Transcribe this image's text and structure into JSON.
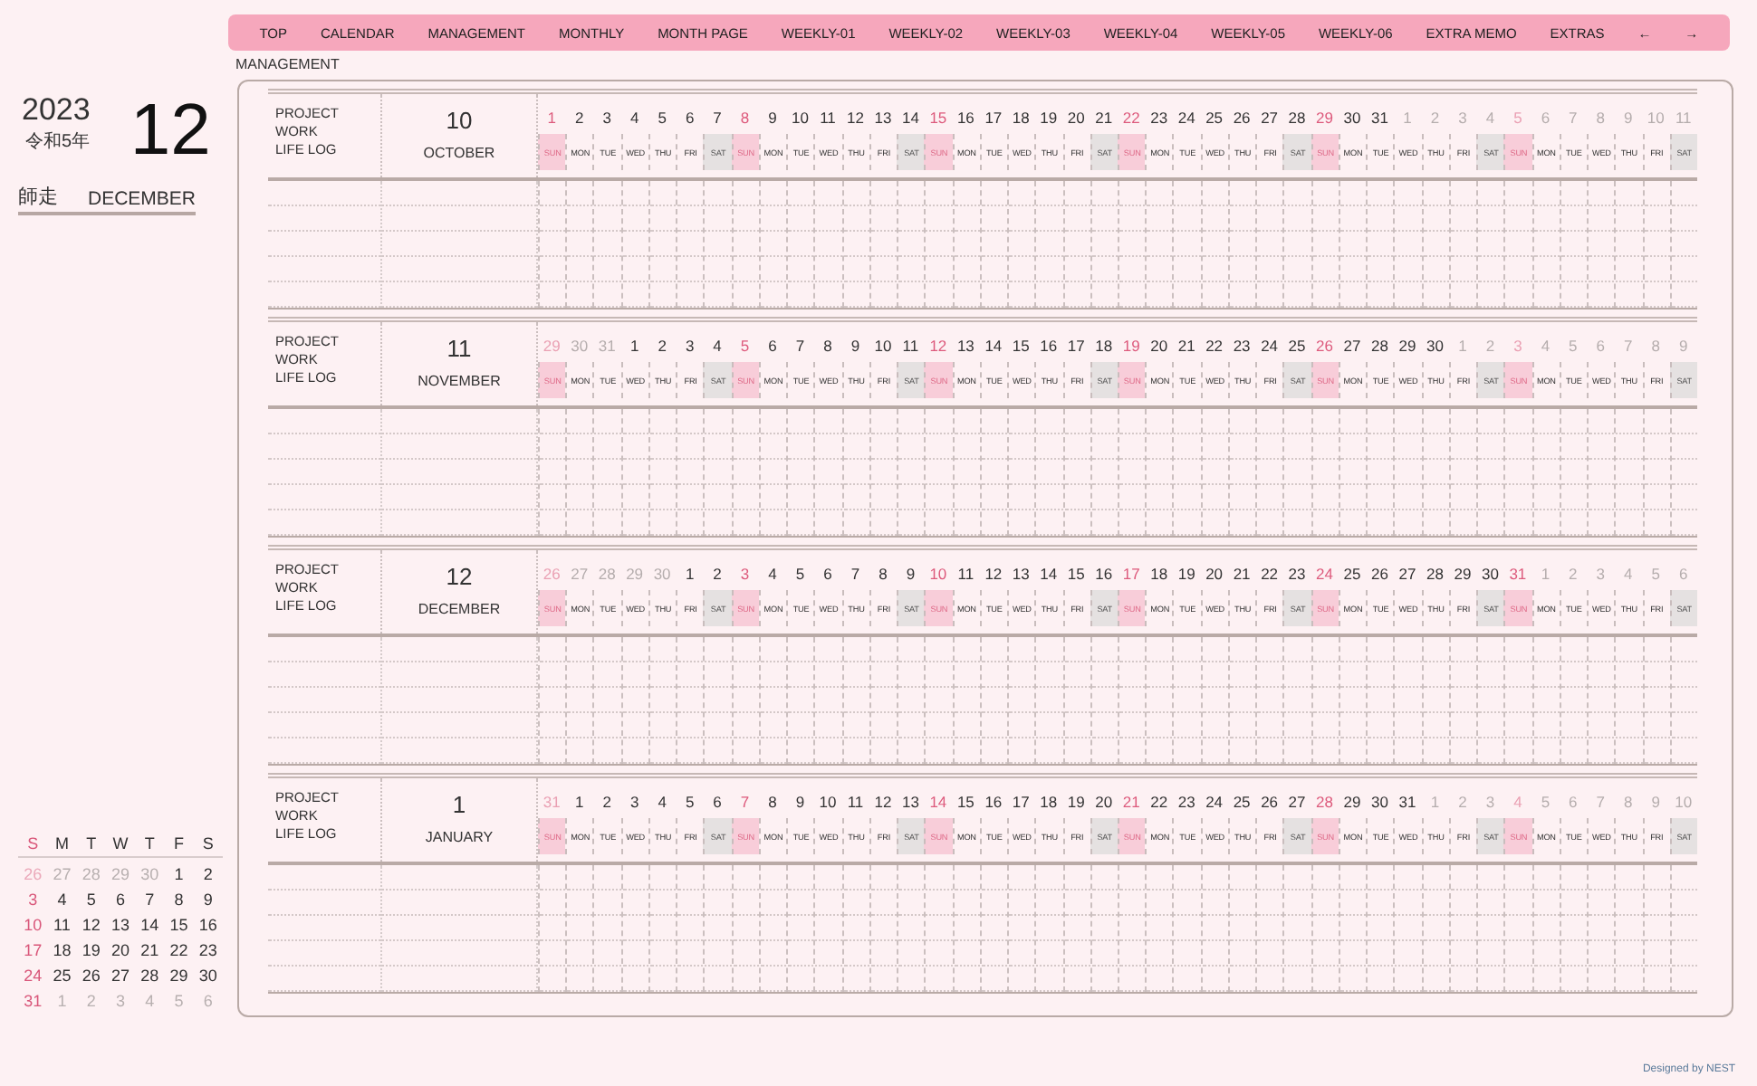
{
  "nav": [
    {
      "label": "TOP"
    },
    {
      "label": "CALENDAR"
    },
    {
      "label": "MANAGEMENT"
    },
    {
      "label": "MONTHLY"
    },
    {
      "label": "MONTH PAGE"
    },
    {
      "label": "WEEKLY-01"
    },
    {
      "label": "WEEKLY-02"
    },
    {
      "label": "WEEKLY-03"
    },
    {
      "label": "WEEKLY-04"
    },
    {
      "label": "WEEKLY-05"
    },
    {
      "label": "WEEKLY-06"
    },
    {
      "label": "EXTRA MEMO"
    },
    {
      "label": "EXTRAS"
    },
    {
      "label": "←"
    },
    {
      "label": "→"
    }
  ],
  "section_label": "MANAGEMENT",
  "side": {
    "year": "2023",
    "era_year": "令和5年",
    "month_number": "12",
    "month_name_japanese": "師走",
    "month_name": "DECEMBER"
  },
  "mini_calendar": {
    "headers": [
      "S",
      "M",
      "T",
      "W",
      "T",
      "F",
      "S"
    ],
    "weeks": [
      [
        {
          "n": "26",
          "out": true
        },
        {
          "n": "27",
          "out": true
        },
        {
          "n": "28",
          "out": true
        },
        {
          "n": "29",
          "out": true
        },
        {
          "n": "30",
          "out": true
        },
        {
          "n": "1",
          "out": false
        },
        {
          "n": "2",
          "out": false
        }
      ],
      [
        {
          "n": "3",
          "out": false
        },
        {
          "n": "4",
          "out": false
        },
        {
          "n": "5",
          "out": false
        },
        {
          "n": "6",
          "out": false
        },
        {
          "n": "7",
          "out": false
        },
        {
          "n": "8",
          "out": false
        },
        {
          "n": "9",
          "out": false
        }
      ],
      [
        {
          "n": "10",
          "out": false
        },
        {
          "n": "11",
          "out": false
        },
        {
          "n": "12",
          "out": false
        },
        {
          "n": "13",
          "out": false
        },
        {
          "n": "14",
          "out": false
        },
        {
          "n": "15",
          "out": false
        },
        {
          "n": "16",
          "out": false
        }
      ],
      [
        {
          "n": "17",
          "out": false
        },
        {
          "n": "18",
          "out": false
        },
        {
          "n": "19",
          "out": false
        },
        {
          "n": "20",
          "out": false
        },
        {
          "n": "21",
          "out": false
        },
        {
          "n": "22",
          "out": false
        },
        {
          "n": "23",
          "out": false
        }
      ],
      [
        {
          "n": "24",
          "out": false
        },
        {
          "n": "25",
          "out": false
        },
        {
          "n": "26",
          "out": false
        },
        {
          "n": "27",
          "out": false
        },
        {
          "n": "28",
          "out": false
        },
        {
          "n": "29",
          "out": false
        },
        {
          "n": "30",
          "out": false
        }
      ],
      [
        {
          "n": "31",
          "out": false
        },
        {
          "n": "1",
          "out": true
        },
        {
          "n": "2",
          "out": true
        },
        {
          "n": "3",
          "out": true
        },
        {
          "n": "4",
          "out": true
        },
        {
          "n": "5",
          "out": true
        },
        {
          "n": "6",
          "out": true
        }
      ]
    ]
  },
  "blocks": [
    {
      "labels": [
        "PROJECT",
        "WORK",
        "LIFE LOG"
      ],
      "month_number": "10",
      "month_name": "OCTOBER",
      "days": [
        {
          "n": "1",
          "w": "SUN",
          "kind": "sun",
          "out": false
        },
        {
          "n": "2",
          "w": "MON",
          "kind": "day",
          "out": false
        },
        {
          "n": "3",
          "w": "TUE",
          "kind": "day",
          "out": false
        },
        {
          "n": "4",
          "w": "WED",
          "kind": "day",
          "out": false
        },
        {
          "n": "5",
          "w": "THU",
          "kind": "day",
          "out": false
        },
        {
          "n": "6",
          "w": "FRI",
          "kind": "day",
          "out": false
        },
        {
          "n": "7",
          "w": "SAT",
          "kind": "sat",
          "out": false
        },
        {
          "n": "8",
          "w": "SUN",
          "kind": "sun",
          "out": false
        },
        {
          "n": "9",
          "w": "MON",
          "kind": "day",
          "out": false
        },
        {
          "n": "10",
          "w": "TUE",
          "kind": "day",
          "out": false
        },
        {
          "n": "11",
          "w": "WED",
          "kind": "day",
          "out": false
        },
        {
          "n": "12",
          "w": "THU",
          "kind": "day",
          "out": false
        },
        {
          "n": "13",
          "w": "FRI",
          "kind": "day",
          "out": false
        },
        {
          "n": "14",
          "w": "SAT",
          "kind": "sat",
          "out": false
        },
        {
          "n": "15",
          "w": "SUN",
          "kind": "sun",
          "out": false
        },
        {
          "n": "16",
          "w": "MON",
          "kind": "day",
          "out": false
        },
        {
          "n": "17",
          "w": "TUE",
          "kind": "day",
          "out": false
        },
        {
          "n": "18",
          "w": "WED",
          "kind": "day",
          "out": false
        },
        {
          "n": "19",
          "w": "THU",
          "kind": "day",
          "out": false
        },
        {
          "n": "20",
          "w": "FRI",
          "kind": "day",
          "out": false
        },
        {
          "n": "21",
          "w": "SAT",
          "kind": "sat",
          "out": false
        },
        {
          "n": "22",
          "w": "SUN",
          "kind": "sun",
          "out": false
        },
        {
          "n": "23",
          "w": "MON",
          "kind": "day",
          "out": false
        },
        {
          "n": "24",
          "w": "TUE",
          "kind": "day",
          "out": false
        },
        {
          "n": "25",
          "w": "WED",
          "kind": "day",
          "out": false
        },
        {
          "n": "26",
          "w": "THU",
          "kind": "day",
          "out": false
        },
        {
          "n": "27",
          "w": "FRI",
          "kind": "day",
          "out": false
        },
        {
          "n": "28",
          "w": "SAT",
          "kind": "sat",
          "out": false
        },
        {
          "n": "29",
          "w": "SUN",
          "kind": "sun",
          "out": false
        },
        {
          "n": "30",
          "w": "MON",
          "kind": "day",
          "out": false
        },
        {
          "n": "31",
          "w": "TUE",
          "kind": "day",
          "out": false
        },
        {
          "n": "1",
          "w": "WED",
          "kind": "day",
          "out": true
        },
        {
          "n": "2",
          "w": "THU",
          "kind": "day",
          "out": true
        },
        {
          "n": "3",
          "w": "FRI",
          "kind": "day",
          "out": true
        },
        {
          "n": "4",
          "w": "SAT",
          "kind": "sat",
          "out": true
        },
        {
          "n": "5",
          "w": "SUN",
          "kind": "sun",
          "out": true
        },
        {
          "n": "6",
          "w": "MON",
          "kind": "day",
          "out": true
        },
        {
          "n": "7",
          "w": "TUE",
          "kind": "day",
          "out": true
        },
        {
          "n": "8",
          "w": "WED",
          "kind": "day",
          "out": true
        },
        {
          "n": "9",
          "w": "THU",
          "kind": "day",
          "out": true
        },
        {
          "n": "10",
          "w": "FRI",
          "kind": "day",
          "out": true
        },
        {
          "n": "11",
          "w": "SAT",
          "kind": "sat",
          "out": true
        }
      ]
    },
    {
      "labels": [
        "PROJECT",
        "WORK",
        "LIFE LOG"
      ],
      "month_number": "11",
      "month_name": "NOVEMBER",
      "days": [
        {
          "n": "29",
          "w": "SUN",
          "kind": "sun",
          "out": true
        },
        {
          "n": "30",
          "w": "MON",
          "kind": "day",
          "out": true
        },
        {
          "n": "31",
          "w": "TUE",
          "kind": "day",
          "out": true
        },
        {
          "n": "1",
          "w": "WED",
          "kind": "day",
          "out": false
        },
        {
          "n": "2",
          "w": "THU",
          "kind": "day",
          "out": false
        },
        {
          "n": "3",
          "w": "FRI",
          "kind": "day",
          "out": false
        },
        {
          "n": "4",
          "w": "SAT",
          "kind": "sat",
          "out": false
        },
        {
          "n": "5",
          "w": "SUN",
          "kind": "sun",
          "out": false
        },
        {
          "n": "6",
          "w": "MON",
          "kind": "day",
          "out": false
        },
        {
          "n": "7",
          "w": "TUE",
          "kind": "day",
          "out": false
        },
        {
          "n": "8",
          "w": "WED",
          "kind": "day",
          "out": false
        },
        {
          "n": "9",
          "w": "THU",
          "kind": "day",
          "out": false
        },
        {
          "n": "10",
          "w": "FRI",
          "kind": "day",
          "out": false
        },
        {
          "n": "11",
          "w": "SAT",
          "kind": "sat",
          "out": false
        },
        {
          "n": "12",
          "w": "SUN",
          "kind": "sun",
          "out": false
        },
        {
          "n": "13",
          "w": "MON",
          "kind": "day",
          "out": false
        },
        {
          "n": "14",
          "w": "TUE",
          "kind": "day",
          "out": false
        },
        {
          "n": "15",
          "w": "WED",
          "kind": "day",
          "out": false
        },
        {
          "n": "16",
          "w": "THU",
          "kind": "day",
          "out": false
        },
        {
          "n": "17",
          "w": "FRI",
          "kind": "day",
          "out": false
        },
        {
          "n": "18",
          "w": "SAT",
          "kind": "sat",
          "out": false
        },
        {
          "n": "19",
          "w": "SUN",
          "kind": "sun",
          "out": false
        },
        {
          "n": "20",
          "w": "MON",
          "kind": "day",
          "out": false
        },
        {
          "n": "21",
          "w": "TUE",
          "kind": "day",
          "out": false
        },
        {
          "n": "22",
          "w": "WED",
          "kind": "day",
          "out": false
        },
        {
          "n": "23",
          "w": "THU",
          "kind": "day",
          "out": false
        },
        {
          "n": "24",
          "w": "FRI",
          "kind": "day",
          "out": false
        },
        {
          "n": "25",
          "w": "SAT",
          "kind": "sat",
          "out": false
        },
        {
          "n": "26",
          "w": "SUN",
          "kind": "sun",
          "out": false
        },
        {
          "n": "27",
          "w": "MON",
          "kind": "day",
          "out": false
        },
        {
          "n": "28",
          "w": "TUE",
          "kind": "day",
          "out": false
        },
        {
          "n": "29",
          "w": "WED",
          "kind": "day",
          "out": false
        },
        {
          "n": "30",
          "w": "THU",
          "kind": "day",
          "out": false
        },
        {
          "n": "1",
          "w": "FRI",
          "kind": "day",
          "out": true
        },
        {
          "n": "2",
          "w": "SAT",
          "kind": "sat",
          "out": true
        },
        {
          "n": "3",
          "w": "SUN",
          "kind": "sun",
          "out": true
        },
        {
          "n": "4",
          "w": "MON",
          "kind": "day",
          "out": true
        },
        {
          "n": "5",
          "w": "TUE",
          "kind": "day",
          "out": true
        },
        {
          "n": "6",
          "w": "WED",
          "kind": "day",
          "out": true
        },
        {
          "n": "7",
          "w": "THU",
          "kind": "day",
          "out": true
        },
        {
          "n": "8",
          "w": "FRI",
          "kind": "day",
          "out": true
        },
        {
          "n": "9",
          "w": "SAT",
          "kind": "sat",
          "out": true
        }
      ]
    },
    {
      "labels": [
        "PROJECT",
        "WORK",
        "LIFE LOG"
      ],
      "month_number": "12",
      "month_name": "DECEMBER",
      "days": [
        {
          "n": "26",
          "w": "SUN",
          "kind": "sun",
          "out": true
        },
        {
          "n": "27",
          "w": "MON",
          "kind": "day",
          "out": true
        },
        {
          "n": "28",
          "w": "TUE",
          "kind": "day",
          "out": true
        },
        {
          "n": "29",
          "w": "WED",
          "kind": "day",
          "out": true
        },
        {
          "n": "30",
          "w": "THU",
          "kind": "day",
          "out": true
        },
        {
          "n": "1",
          "w": "FRI",
          "kind": "day",
          "out": false
        },
        {
          "n": "2",
          "w": "SAT",
          "kind": "sat",
          "out": false
        },
        {
          "n": "3",
          "w": "SUN",
          "kind": "sun",
          "out": false
        },
        {
          "n": "4",
          "w": "MON",
          "kind": "day",
          "out": false
        },
        {
          "n": "5",
          "w": "TUE",
          "kind": "day",
          "out": false
        },
        {
          "n": "6",
          "w": "WED",
          "kind": "day",
          "out": false
        },
        {
          "n": "7",
          "w": "THU",
          "kind": "day",
          "out": false
        },
        {
          "n": "8",
          "w": "FRI",
          "kind": "day",
          "out": false
        },
        {
          "n": "9",
          "w": "SAT",
          "kind": "sat",
          "out": false
        },
        {
          "n": "10",
          "w": "SUN",
          "kind": "sun",
          "out": false
        },
        {
          "n": "11",
          "w": "MON",
          "kind": "day",
          "out": false
        },
        {
          "n": "12",
          "w": "TUE",
          "kind": "day",
          "out": false
        },
        {
          "n": "13",
          "w": "WED",
          "kind": "day",
          "out": false
        },
        {
          "n": "14",
          "w": "THU",
          "kind": "day",
          "out": false
        },
        {
          "n": "15",
          "w": "FRI",
          "kind": "day",
          "out": false
        },
        {
          "n": "16",
          "w": "SAT",
          "kind": "sat",
          "out": false
        },
        {
          "n": "17",
          "w": "SUN",
          "kind": "sun",
          "out": false
        },
        {
          "n": "18",
          "w": "MON",
          "kind": "day",
          "out": false
        },
        {
          "n": "19",
          "w": "TUE",
          "kind": "day",
          "out": false
        },
        {
          "n": "20",
          "w": "WED",
          "kind": "day",
          "out": false
        },
        {
          "n": "21",
          "w": "THU",
          "kind": "day",
          "out": false
        },
        {
          "n": "22",
          "w": "FRI",
          "kind": "day",
          "out": false
        },
        {
          "n": "23",
          "w": "SAT",
          "kind": "sat",
          "out": false
        },
        {
          "n": "24",
          "w": "SUN",
          "kind": "sun",
          "out": false
        },
        {
          "n": "25",
          "w": "MON",
          "kind": "day",
          "out": false
        },
        {
          "n": "26",
          "w": "TUE",
          "kind": "day",
          "out": false
        },
        {
          "n": "27",
          "w": "WED",
          "kind": "day",
          "out": false
        },
        {
          "n": "28",
          "w": "THU",
          "kind": "day",
          "out": false
        },
        {
          "n": "29",
          "w": "FRI",
          "kind": "day",
          "out": false
        },
        {
          "n": "30",
          "w": "SAT",
          "kind": "sat",
          "out": false
        },
        {
          "n": "31",
          "w": "SUN",
          "kind": "sun",
          "out": false
        },
        {
          "n": "1",
          "w": "MON",
          "kind": "day",
          "out": true
        },
        {
          "n": "2",
          "w": "TUE",
          "kind": "day",
          "out": true
        },
        {
          "n": "3",
          "w": "WED",
          "kind": "day",
          "out": true
        },
        {
          "n": "4",
          "w": "THU",
          "kind": "day",
          "out": true
        },
        {
          "n": "5",
          "w": "FRI",
          "kind": "day",
          "out": true
        },
        {
          "n": "6",
          "w": "SAT",
          "kind": "sat",
          "out": true
        }
      ]
    },
    {
      "labels": [
        "PROJECT",
        "WORK",
        "LIFE LOG"
      ],
      "month_number": "1",
      "month_name": "JANUARY",
      "days": [
        {
          "n": "31",
          "w": "SUN",
          "kind": "sun",
          "out": true
        },
        {
          "n": "1",
          "w": "MON",
          "kind": "day",
          "out": false
        },
        {
          "n": "2",
          "w": "TUE",
          "kind": "day",
          "out": false
        },
        {
          "n": "3",
          "w": "WED",
          "kind": "day",
          "out": false
        },
        {
          "n": "4",
          "w": "THU",
          "kind": "day",
          "out": false
        },
        {
          "n": "5",
          "w": "FRI",
          "kind": "day",
          "out": false
        },
        {
          "n": "6",
          "w": "SAT",
          "kind": "sat",
          "out": false
        },
        {
          "n": "7",
          "w": "SUN",
          "kind": "sun",
          "out": false
        },
        {
          "n": "8",
          "w": "MON",
          "kind": "day",
          "out": false
        },
        {
          "n": "9",
          "w": "TUE",
          "kind": "day",
          "out": false
        },
        {
          "n": "10",
          "w": "WED",
          "kind": "day",
          "out": false
        },
        {
          "n": "11",
          "w": "THU",
          "kind": "day",
          "out": false
        },
        {
          "n": "12",
          "w": "FRI",
          "kind": "day",
          "out": false
        },
        {
          "n": "13",
          "w": "SAT",
          "kind": "sat",
          "out": false
        },
        {
          "n": "14",
          "w": "SUN",
          "kind": "sun",
          "out": false
        },
        {
          "n": "15",
          "w": "MON",
          "kind": "day",
          "out": false
        },
        {
          "n": "16",
          "w": "TUE",
          "kind": "day",
          "out": false
        },
        {
          "n": "17",
          "w": "WED",
          "kind": "day",
          "out": false
        },
        {
          "n": "18",
          "w": "THU",
          "kind": "day",
          "out": false
        },
        {
          "n": "19",
          "w": "FRI",
          "kind": "day",
          "out": false
        },
        {
          "n": "20",
          "w": "SAT",
          "kind": "sat",
          "out": false
        },
        {
          "n": "21",
          "w": "SUN",
          "kind": "sun",
          "out": false
        },
        {
          "n": "22",
          "w": "MON",
          "kind": "day",
          "out": false
        },
        {
          "n": "23",
          "w": "TUE",
          "kind": "day",
          "out": false
        },
        {
          "n": "24",
          "w": "WED",
          "kind": "day",
          "out": false
        },
        {
          "n": "25",
          "w": "THU",
          "kind": "day",
          "out": false
        },
        {
          "n": "26",
          "w": "FRI",
          "kind": "day",
          "out": false
        },
        {
          "n": "27",
          "w": "SAT",
          "kind": "sat",
          "out": false
        },
        {
          "n": "28",
          "w": "SUN",
          "kind": "sun",
          "out": false
        },
        {
          "n": "29",
          "w": "MON",
          "kind": "day",
          "out": false
        },
        {
          "n": "30",
          "w": "TUE",
          "kind": "day",
          "out": false
        },
        {
          "n": "31",
          "w": "WED",
          "kind": "day",
          "out": false
        },
        {
          "n": "1",
          "w": "THU",
          "kind": "day",
          "out": true
        },
        {
          "n": "2",
          "w": "FRI",
          "kind": "day",
          "out": true
        },
        {
          "n": "3",
          "w": "SAT",
          "kind": "sat",
          "out": true
        },
        {
          "n": "4",
          "w": "SUN",
          "kind": "sun",
          "out": true
        },
        {
          "n": "5",
          "w": "MON",
          "kind": "day",
          "out": true
        },
        {
          "n": "6",
          "w": "TUE",
          "kind": "day",
          "out": true
        },
        {
          "n": "7",
          "w": "WED",
          "kind": "day",
          "out": true
        },
        {
          "n": "8",
          "w": "THU",
          "kind": "day",
          "out": true
        },
        {
          "n": "9",
          "w": "FRI",
          "kind": "day",
          "out": true
        },
        {
          "n": "10",
          "w": "SAT",
          "kind": "sat",
          "out": true
        }
      ]
    }
  ],
  "credit": "Designed by NEST"
}
